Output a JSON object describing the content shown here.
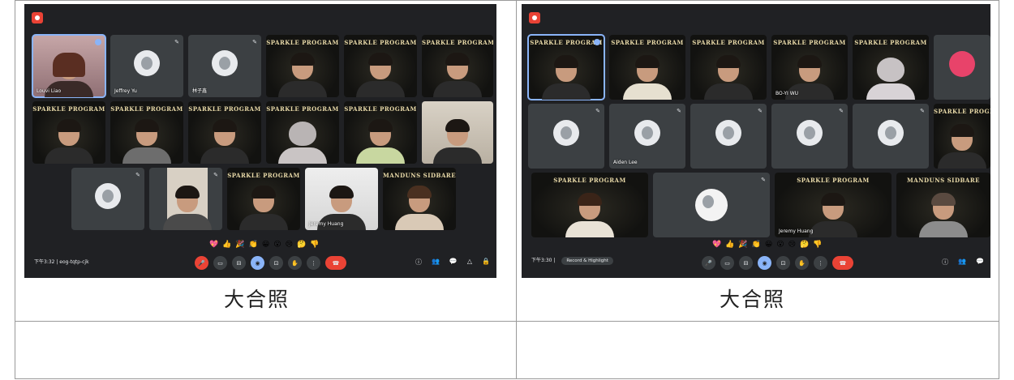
{
  "captions": [
    "大合照",
    "大合照"
  ],
  "banner_text": "SPARKLE PROGRAM",
  "banner_text_alt": "MANDUNS SIDBARE",
  "mic_glyph": "✎",
  "left": {
    "names": [
      "Louvi Liao",
      "Jeffrey Yu",
      "林子鑫",
      "",
      "",
      "",
      "",
      "",
      "",
      "",
      "",
      "",
      "",
      "",
      "",
      "",
      "",
      "",
      "",
      "Jeremy Huang",
      ""
    ],
    "time_meeting": "下午3:32 | eog-tqtp-cjk",
    "reactions": "💖👍🎉👏😀😮😢🤔👎",
    "controls": [
      "🎤",
      "▭",
      "⊟",
      "◉",
      "⊡",
      "✋",
      "⋮",
      "☎"
    ],
    "right_controls": [
      "ⓘ",
      "👥",
      "💬",
      "△",
      "🔒"
    ]
  },
  "right": {
    "names": [
      "",
      "",
      "",
      "BO-YI WU",
      "",
      "",
      "",
      "",
      "",
      "Aiden Lee",
      "",
      "",
      "",
      "",
      "",
      "",
      "",
      "Jeremy Huang",
      ""
    ],
    "avatar_text": "",
    "time_meeting": "下午3:30 | ",
    "chip_label": "Record & Highlight",
    "reactions": "💖👍🎉👏😀😮😢🤔👎",
    "controls": [
      "🎤",
      "▭",
      "⊟",
      "◉",
      "⊡",
      "✋",
      "⋮",
      "☎"
    ],
    "right_controls": [
      "ⓘ",
      "👥",
      "💬"
    ]
  }
}
